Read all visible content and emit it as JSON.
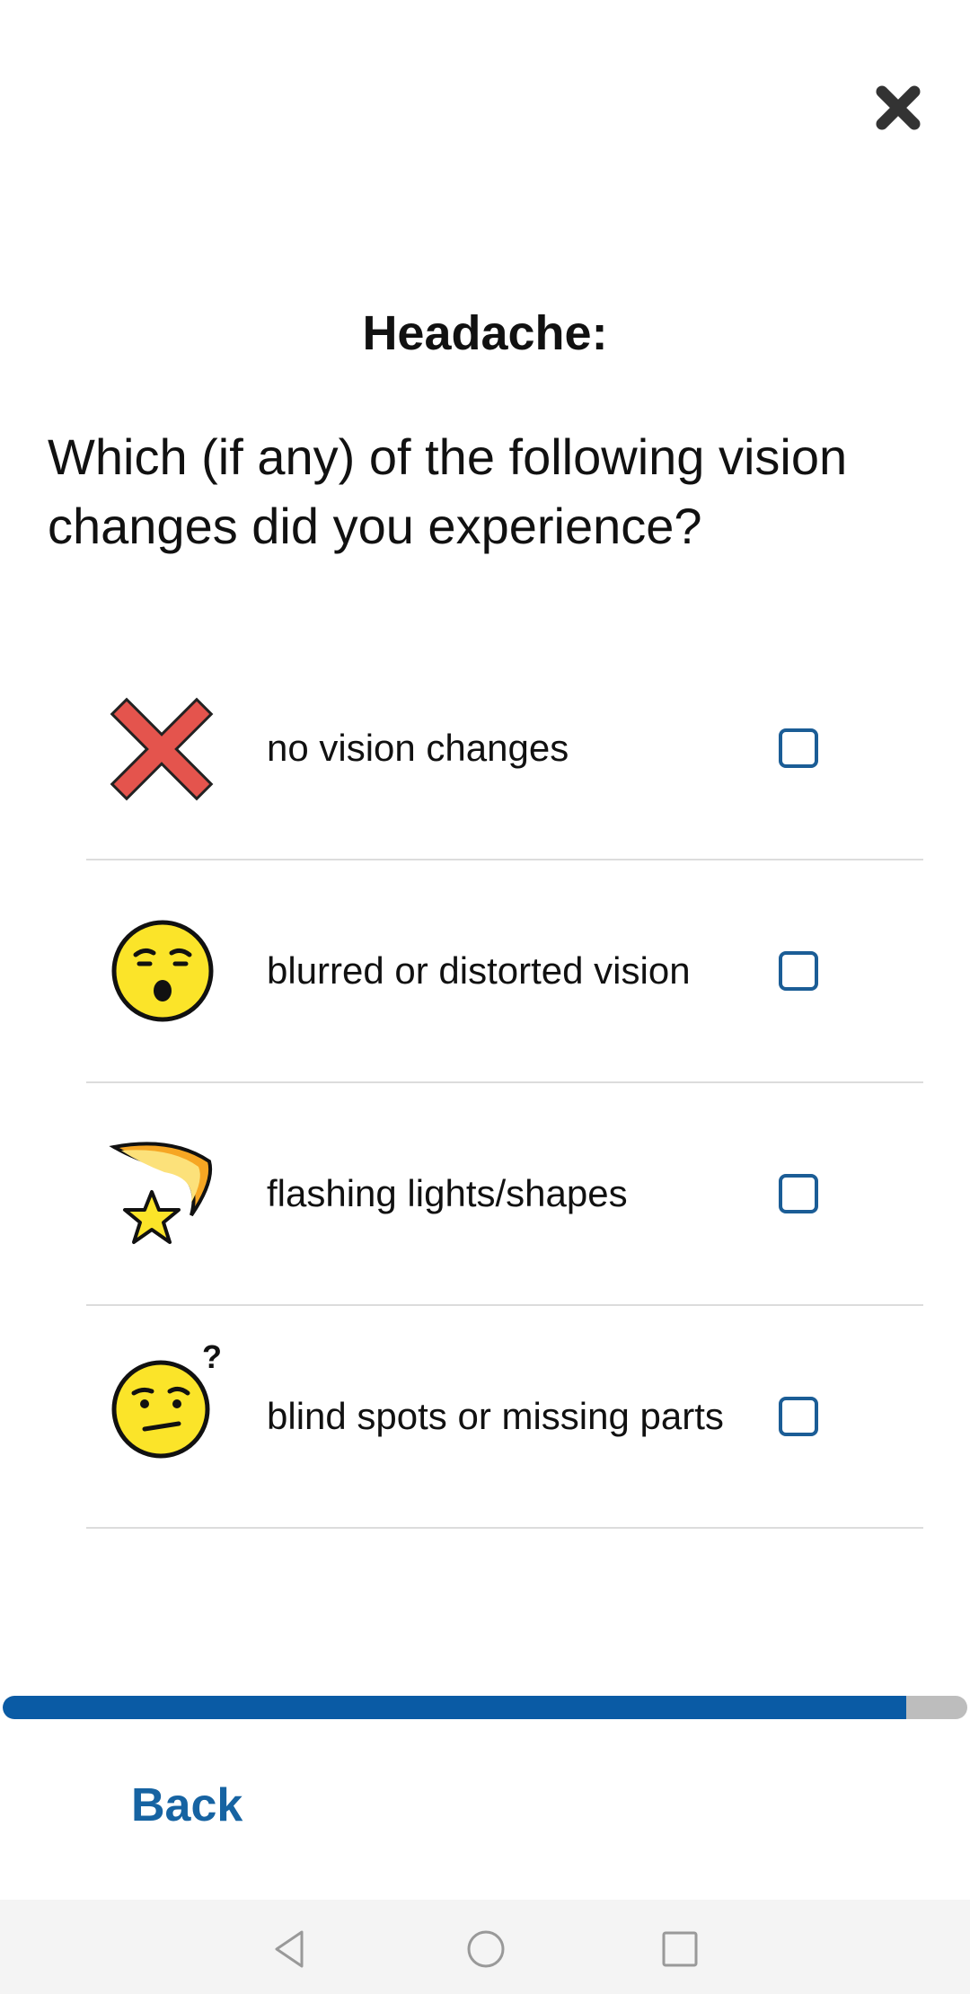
{
  "header": {
    "close_icon": "close-icon"
  },
  "title": "Headache:",
  "question": "Which (if any) of the following vision changes did you experience?",
  "options": [
    {
      "label": "no vision changes",
      "icon": "red-x-icon",
      "checked": false
    },
    {
      "label": "blurred or distorted vision",
      "icon": "astonished-face-icon",
      "checked": false
    },
    {
      "label": "flashing lights/shapes",
      "icon": "shooting-star-icon",
      "checked": false
    },
    {
      "label": "blind spots or missing parts",
      "icon": "confused-face-icon",
      "checked": false
    }
  ],
  "progress": {
    "value": 0.937
  },
  "footer": {
    "back_label": "Back"
  },
  "colors": {
    "accent": "#0a5ba5",
    "checkbox": "#1b5d96",
    "track": "#bdbdbd",
    "link": "#1663a2"
  },
  "navbar": {
    "icons": [
      "back-triangle-icon",
      "home-circle-icon",
      "recents-square-icon"
    ]
  }
}
